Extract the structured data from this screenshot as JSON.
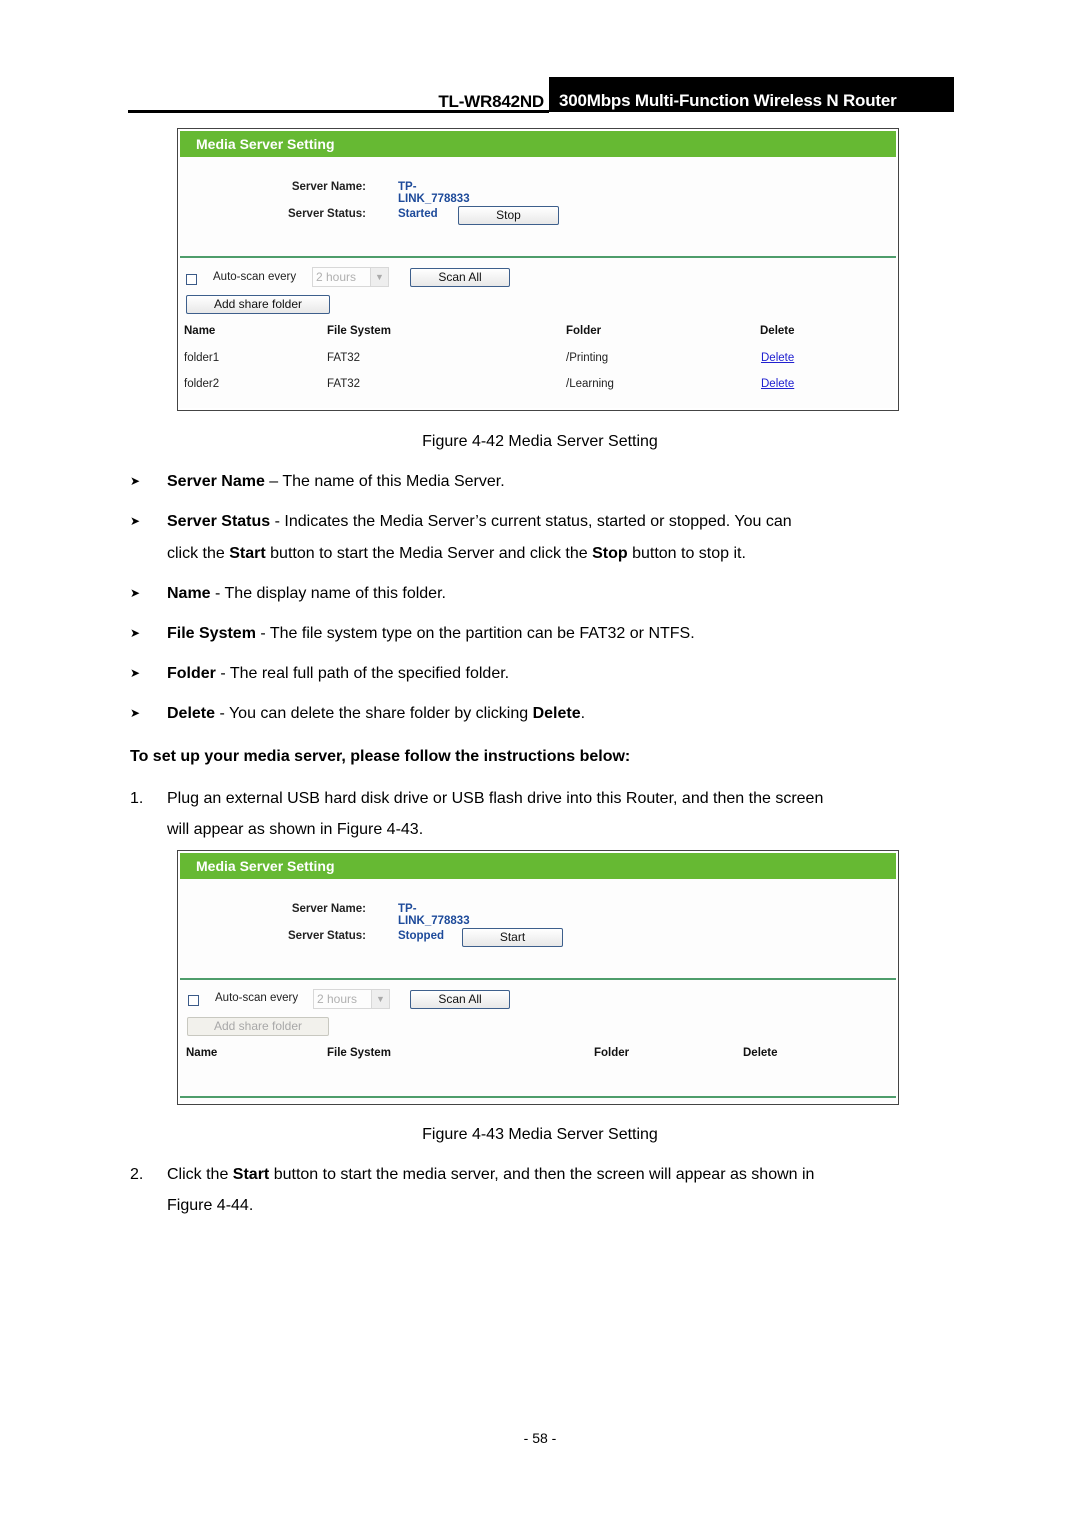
{
  "header": {
    "model": "TL-WR842ND",
    "product": "300Mbps Multi-Function Wireless N Router"
  },
  "figure1": {
    "panel_title": "Media Server Setting",
    "server_name_label": "Server Name:",
    "server_name_value": "TP-LINK_778833",
    "server_status_label": "Server Status:",
    "server_status_value": "Started",
    "toggle_button": "Stop",
    "auto_scan_label": "Auto-scan every",
    "auto_scan_checked": false,
    "auto_scan_interval": "2 hours",
    "scan_all_button": "Scan All",
    "add_share_folder_button": "Add share folder",
    "add_share_folder_disabled": false,
    "columns": [
      "Name",
      "File System",
      "Folder",
      "Delete"
    ],
    "rows": [
      {
        "name": "folder1",
        "file_system": "FAT32",
        "folder": "/Printing",
        "delete": "Delete"
      },
      {
        "name": "folder2",
        "file_system": "FAT32",
        "folder": "/Learning",
        "delete": "Delete"
      }
    ],
    "caption": "Figure 4-42 Media Server Setting"
  },
  "descriptions": [
    {
      "term": "Server Name",
      "sep": " – ",
      "text": "The name of this Media Server."
    },
    {
      "term": "Server Status",
      "sep": " - ",
      "text": "Indicates the Media Server’s current status, started or stopped. You can",
      "line2_pre": "click the ",
      "line2_b1": "Start",
      "line2_mid": " button to start the Media Server and click the ",
      "line2_b2": "Stop",
      "line2_post": " button to stop it."
    },
    {
      "term": "Name",
      "sep": " - ",
      "text": "The display name of this folder."
    },
    {
      "term": "File System",
      "sep": " - ",
      "text": "The file system type on the partition can be FAT32 or NTFS."
    },
    {
      "term": "Folder",
      "sep": " - ",
      "text": "The real full path of the specified folder."
    },
    {
      "term": "Delete",
      "sep": " - ",
      "text": "You can delete the share folder by clicking ",
      "trail_bold": "Delete",
      "trail": "."
    }
  ],
  "instructions_heading": "To set up your media server, please follow the instructions below:",
  "steps": [
    {
      "num": "1.",
      "line1": "Plug an external USB hard disk drive or USB flash drive into this Router, and then the screen",
      "line2": "will appear as shown in Figure 4-43."
    },
    {
      "num": "2.",
      "pre": "Click the ",
      "bold": "Start",
      "line1_post": " button to start the media server, and then the screen will appear as shown in",
      "line2": "Figure 4-44."
    }
  ],
  "figure2": {
    "panel_title": "Media Server Setting",
    "server_name_label": "Server Name:",
    "server_name_value": "TP-LINK_778833",
    "server_status_label": "Server Status:",
    "server_status_value": "Stopped",
    "toggle_button": "Start",
    "auto_scan_label": "Auto-scan every",
    "auto_scan_checked": false,
    "auto_scan_interval": "2 hours",
    "scan_all_button": "Scan All",
    "add_share_folder_button": "Add share folder",
    "add_share_folder_disabled": true,
    "columns": [
      "Name",
      "File System",
      "Folder",
      "Delete"
    ],
    "rows": [],
    "caption": "Figure 4-43 Media Server Setting"
  },
  "page_number": "- 58 -",
  "colors": {
    "panel_header_green": "#66b933",
    "status_blue": "#1d4a9a",
    "link_blue": "#2020d0"
  }
}
